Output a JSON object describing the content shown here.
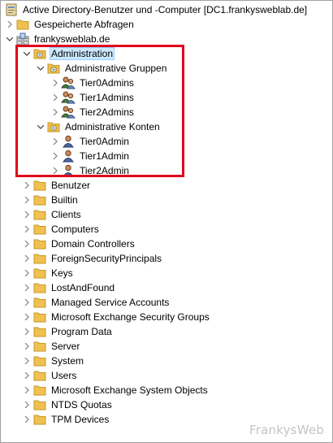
{
  "tree": {
    "root_label": "Active Directory-Benutzer und -Computer [DC1.frankysweblab.de]",
    "saved_queries_label": "Gespeicherte Abfragen",
    "domain_label": "frankysweblab.de",
    "administration": {
      "label": "Administration",
      "groups_folder": {
        "label": "Administrative Gruppen",
        "items": [
          "Tier0Admins",
          "Tier1Admins",
          "Tier2Admins"
        ]
      },
      "accounts_folder": {
        "label": "Administrative Konten",
        "items": [
          "Tier0Admin",
          "Tier1Admin",
          "Tier2Admin"
        ]
      }
    },
    "containers": [
      "Benutzer",
      "Builtin",
      "Clients",
      "Computers",
      "Domain Controllers",
      "ForeignSecurityPrincipals",
      "Keys",
      "LostAndFound",
      "Managed Service Accounts",
      "Microsoft Exchange Security Groups",
      "Program Data",
      "Server",
      "System",
      "Users",
      "Microsoft Exchange System Objects",
      "NTDS Quotas",
      "TPM Devices"
    ]
  },
  "colors": {
    "selection": "#cce8ff",
    "highlight_border": "#e2001a",
    "folder": "#f0c050",
    "watermark": "#c4c4c4"
  },
  "watermark": "FrankysWeb"
}
